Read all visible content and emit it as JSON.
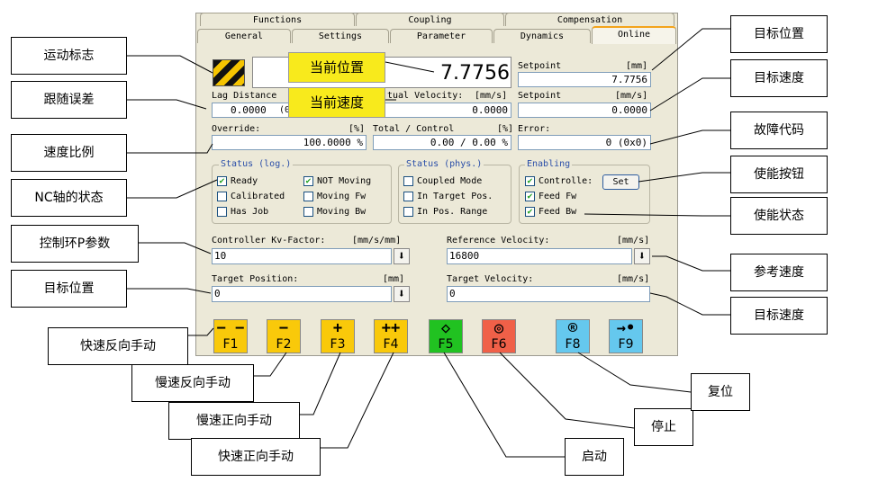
{
  "tabs_row1": [
    "Functions",
    "Coupling",
    "Compensation"
  ],
  "tabs_row2": [
    "General",
    "Settings",
    "Parameter",
    "Dynamics",
    "Online"
  ],
  "online": {
    "position_value": "7.7756",
    "setpoint_label": "Setpoint",
    "setpoint_unit": "[mm]",
    "setpoint_value": "7.7756",
    "lag_label": "Lag Distance",
    "lag_value": "0.0000",
    "lag_paren": "(0",
    "actvel_label": "tual Velocity:",
    "actvel_unit": "[mm/s]",
    "actvel_value": "0.0000",
    "setvel_label": "Setpoint",
    "setvel_unit": "[mm/s]",
    "setvel_value": "0.0000",
    "override_label": "Override:",
    "override_unit": "[%]",
    "override_value": "100.0000 %",
    "total_label": "Total / Control",
    "total_unit": "[%]",
    "total_value": "0.00 /  0.00 %",
    "error_label": "Error:",
    "error_value": "0 (0x0)"
  },
  "status_log": {
    "title": "Status (log.)",
    "items": [
      {
        "label": "Ready",
        "checked": true
      },
      {
        "label": "NOT Moving",
        "checked": true
      },
      {
        "label": "Calibrated",
        "checked": false
      },
      {
        "label": "Moving Fw",
        "checked": false
      },
      {
        "label": "Has Job",
        "checked": false
      },
      {
        "label": "Moving Bw",
        "checked": false
      }
    ]
  },
  "status_phys": {
    "title": "Status (phys.)",
    "items": [
      {
        "label": "Coupled Mode",
        "checked": false
      },
      {
        "label": "In Target Pos.",
        "checked": false
      },
      {
        "label": "In Pos. Range",
        "checked": false
      }
    ]
  },
  "enabling": {
    "title": "Enabling",
    "items": [
      {
        "label": "Controlle:",
        "checked": true
      },
      {
        "label": "Feed Fw",
        "checked": true
      },
      {
        "label": "Feed Bw",
        "checked": true
      }
    ],
    "set_label": "Set"
  },
  "params": {
    "kv_label": "Controller Kv-Factor:",
    "kv_unit": "[mm/s/mm]",
    "kv_value": "10",
    "refvel_label": "Reference Velocity:",
    "refvel_unit": "[mm/s]",
    "refvel_value": "16800",
    "tpos_label": "Target Position:",
    "tpos_unit": "[mm]",
    "tpos_value": "0",
    "tvel_label": "Target Velocity:",
    "tvel_unit": "[mm/s]",
    "tvel_value": "0"
  },
  "fkeys": [
    {
      "sym": "− −",
      "key": "F1",
      "color": "#f9c90a"
    },
    {
      "sym": "−",
      "key": "F2",
      "color": "#f9c90a"
    },
    {
      "sym": "+",
      "key": "F3",
      "color": "#f9c90a"
    },
    {
      "sym": "++",
      "key": "F4",
      "color": "#f9c90a"
    },
    {
      "sym": "◇",
      "key": "F5",
      "color": "#21c221"
    },
    {
      "sym": "◎",
      "key": "F6",
      "color": "#f06048"
    },
    {
      "sym": "®",
      "key": "F8",
      "color": "#65c8ee"
    },
    {
      "sym": "→•",
      "key": "F9",
      "color": "#65c8ee"
    }
  ],
  "tags": {
    "cur_pos": "当前位置",
    "cur_vel": "当前速度"
  },
  "callouts": {
    "motion_flag": "运动标志",
    "lag_error": "跟随误差",
    "speed_ratio": "速度比例",
    "nc_state": "NC轴的状态",
    "kp_param": "控制环P参数",
    "target_pos_left": "目标位置",
    "fast_rev": "快速反向手动",
    "slow_rev": "慢速反向手动",
    "slow_fwd": "慢速正向手动",
    "fast_fwd": "快速正向手动",
    "start": "启动",
    "stop": "停止",
    "reset": "复位",
    "target_pos_right": "目标位置",
    "target_vel_right": "目标速度",
    "fault_code": "故障代码",
    "enable_btn": "使能按钮",
    "enable_state": "使能状态",
    "ref_vel": "参考速度",
    "target_vel_right2": "目标速度"
  }
}
